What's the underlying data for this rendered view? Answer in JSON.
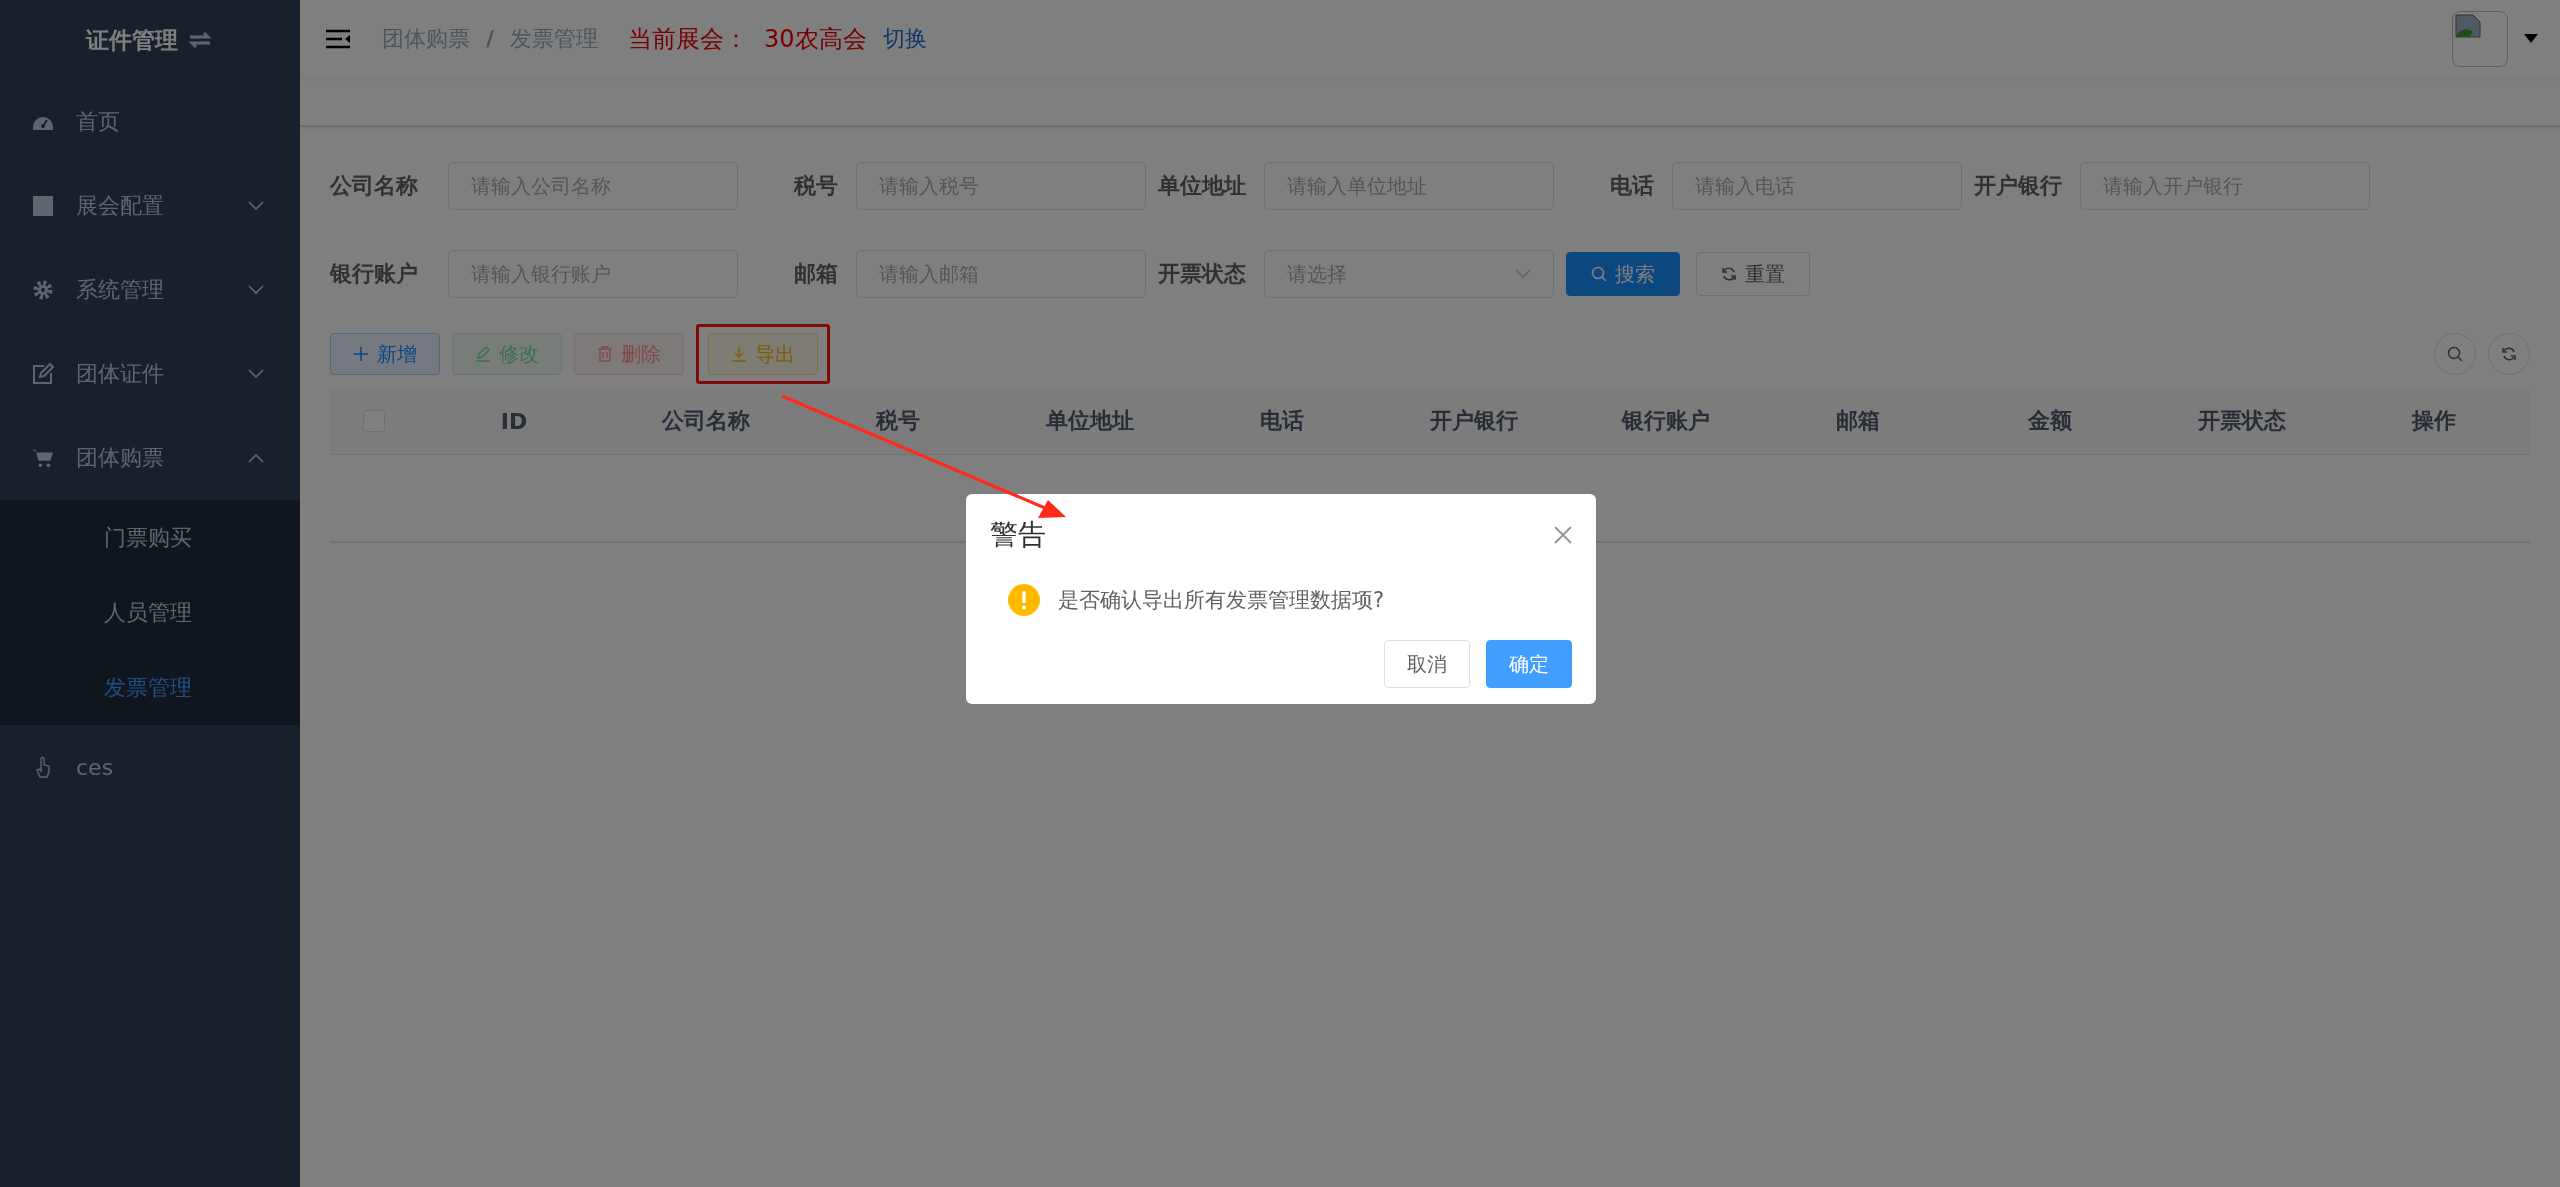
{
  "sidebar": {
    "title": "证件管理",
    "items": [
      {
        "label": "首页",
        "selected": false
      },
      {
        "label": "展会配置",
        "selected": false,
        "expanded": false
      },
      {
        "label": "系统管理",
        "selected": false,
        "expanded": false
      },
      {
        "label": "团体证件",
        "selected": false,
        "expanded": false
      },
      {
        "label": "团体购票",
        "selected": false,
        "expanded": true,
        "children": [
          {
            "label": "门票购买",
            "selected": false
          },
          {
            "label": "人员管理",
            "selected": false
          },
          {
            "label": "发票管理",
            "selected": true
          }
        ]
      },
      {
        "label": "ces",
        "selected": false
      }
    ]
  },
  "header": {
    "breadcrumb": [
      "团体购票",
      "发票管理"
    ],
    "breadcrumb_separator": "/",
    "exhibition_label": "当前展会：",
    "exhibition_name": "30农高会",
    "switch_link": "切换"
  },
  "filters": [
    {
      "label": "公司名称",
      "placeholder": "请输入公司名称",
      "kind": "input"
    },
    {
      "label": "税号",
      "placeholder": "请输入税号",
      "kind": "input"
    },
    {
      "label": "单位地址",
      "placeholder": "请输入单位地址",
      "kind": "input"
    },
    {
      "label": "电话",
      "placeholder": "请输入电话",
      "kind": "input"
    },
    {
      "label": "开户银行",
      "placeholder": "请输入开户银行",
      "kind": "input"
    },
    {
      "label": "银行账户",
      "placeholder": "请输入银行账户",
      "kind": "input"
    },
    {
      "label": "邮箱",
      "placeholder": "请输入邮箱",
      "kind": "input"
    },
    {
      "label": "开票状态",
      "placeholder": "请选择",
      "kind": "select"
    }
  ],
  "search_button": "搜索",
  "reset_button": "重置",
  "toolbar": [
    {
      "label": "新增",
      "kind": "add",
      "annotated": false
    },
    {
      "label": "修改",
      "kind": "edit",
      "annotated": false
    },
    {
      "label": "删除",
      "kind": "delete",
      "annotated": false
    },
    {
      "label": "导出",
      "kind": "export",
      "annotated": true
    }
  ],
  "table": {
    "select_all_checked": false,
    "columns": [
      "ID",
      "公司名称",
      "税号",
      "单位地址",
      "电话",
      "开户银行",
      "银行账户",
      "邮箱",
      "金额",
      "开票状态",
      "操作"
    ]
  },
  "dialog": {
    "title": "警告",
    "message": "是否确认导出所有发票管理数据项?",
    "buttons": [
      {
        "label": "取消",
        "kind": "default"
      },
      {
        "label": "确定",
        "kind": "primary"
      }
    ]
  }
}
